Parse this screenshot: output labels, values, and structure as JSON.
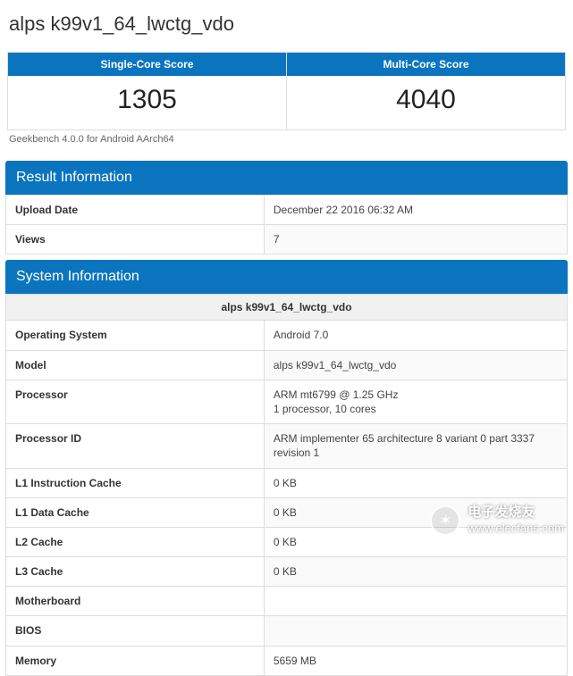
{
  "title": "alps k99v1_64_lwctg_vdo",
  "scores": {
    "single_label": "Single-Core Score",
    "single_value": "1305",
    "multi_label": "Multi-Core Score",
    "multi_value": "4040"
  },
  "footnote": "Geekbench 4.0.0 for Android AArch64",
  "sections": {
    "result_label": "Result Information",
    "system_label": "System Information"
  },
  "result_rows": [
    {
      "label": "Upload Date",
      "value": "December 22 2016 06:32 AM"
    },
    {
      "label": "Views",
      "value": "7"
    }
  ],
  "system_header": "alps k99v1_64_lwctg_vdo",
  "system_rows": [
    {
      "label": "Operating System",
      "value": "Android 7.0"
    },
    {
      "label": "Model",
      "value": "alps k99v1_64_lwctg_vdo"
    },
    {
      "label": "Processor",
      "value": "ARM mt6799 @ 1.25 GHz\n1 processor, 10 cores"
    },
    {
      "label": "Processor ID",
      "value": "ARM implementer 65 architecture 8 variant 0 part 3337 revision 1"
    },
    {
      "label": "L1 Instruction Cache",
      "value": "0 KB"
    },
    {
      "label": "L1 Data Cache",
      "value": "0 KB"
    },
    {
      "label": "L2 Cache",
      "value": "0 KB"
    },
    {
      "label": "L3 Cache",
      "value": "0 KB"
    },
    {
      "label": "Motherboard",
      "value": ""
    },
    {
      "label": "BIOS",
      "value": ""
    },
    {
      "label": "Memory",
      "value": "5659 MB"
    }
  ],
  "watermark": {
    "chinese": "电子发烧友",
    "url": "www.elecfans.com"
  }
}
